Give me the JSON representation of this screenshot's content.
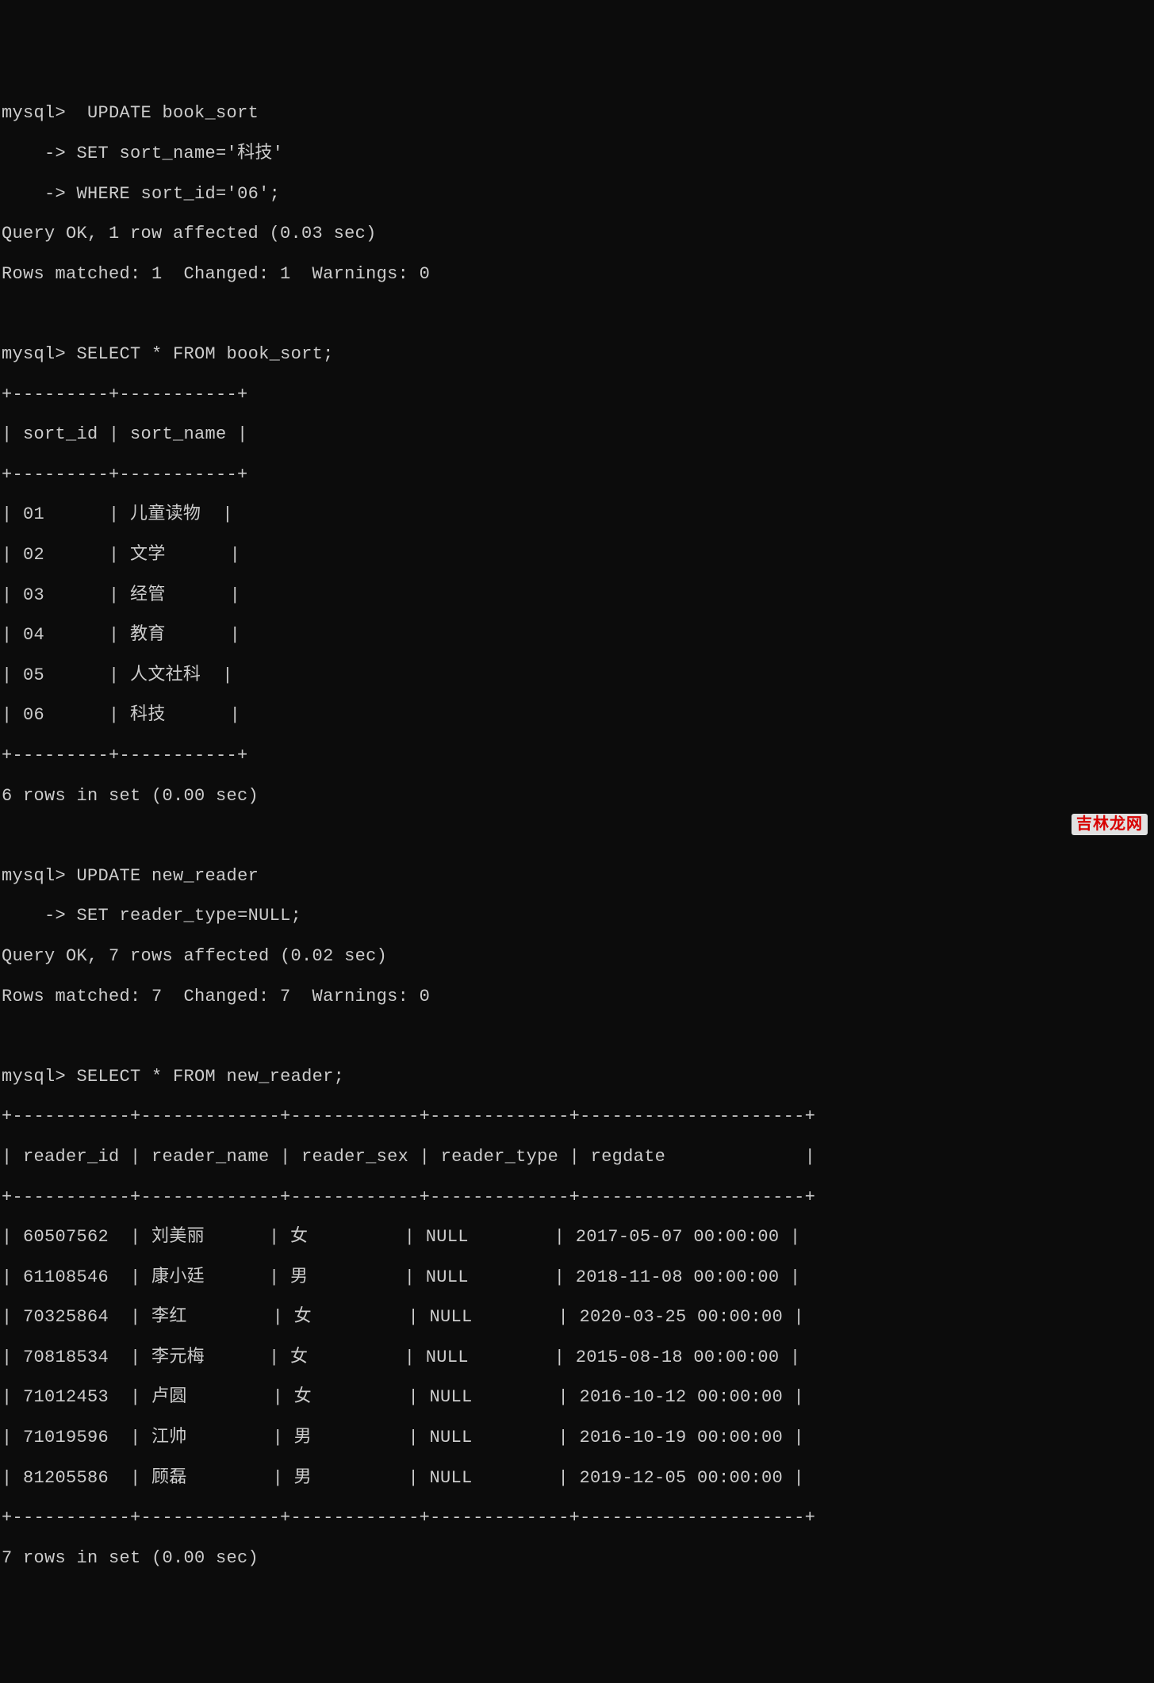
{
  "prompt": "mysql>",
  "cont_prompt": "    ->",
  "query1": {
    "l1": " UPDATE book_sort",
    "l2": "SET sort_name='科技'",
    "l3": "WHERE sort_id='06';"
  },
  "result1": {
    "l1": "Query OK, 1 row affected (0.03 sec)",
    "l2": "Rows matched: 1  Changed: 1  Warnings: 0"
  },
  "query2": "SELECT * FROM book_sort;",
  "table1": {
    "border_top": "+---------+-----------+",
    "header": "| sort_id | sort_name |",
    "border_mid": "+---------+-----------+",
    "rows": [
      "| 01      | 儿童读物  |",
      "| 02      | 文学      |",
      "| 03      | 经管      |",
      "| 04      | 教育      |",
      "| 05      | 人文社科  |",
      "| 06      | 科技      |"
    ],
    "border_bot": "+---------+-----------+",
    "footer": "6 rows in set (0.00 sec)"
  },
  "query3": {
    "l1": "UPDATE new_reader",
    "l2": "SET reader_type=NULL;"
  },
  "result3": {
    "l1": "Query OK, 7 rows affected (0.02 sec)",
    "l2": "Rows matched: 7  Changed: 7  Warnings: 0"
  },
  "query4": "SELECT * FROM new_reader;",
  "table2": {
    "border_top": "+-----------+-------------+------------+-------------+---------------------+",
    "header": "| reader_id | reader_name | reader_sex | reader_type | regdate             |",
    "border_mid": "+-----------+-------------+------------+-------------+---------------------+",
    "rows": [
      "| 60507562  | 刘美丽      | 女         | NULL        | 2017-05-07 00:00:00 |",
      "| 61108546  | 康小廷      | 男         | NULL        | 2018-11-08 00:00:00 |",
      "| 70325864  | 李红        | 女         | NULL        | 2020-03-25 00:00:00 |",
      "| 70818534  | 李元梅      | 女         | NULL        | 2015-08-18 00:00:00 |",
      "| 71012453  | 卢圆        | 女         | NULL        | 2016-10-12 00:00:00 |",
      "| 71019596  | 江帅        | 男         | NULL        | 2016-10-19 00:00:00 |",
      "| 81205586  | 顾磊        | 男         | NULL        | 2019-12-05 00:00:00 |"
    ],
    "border_bot": "+-----------+-------------+------------+-------------+---------------------+",
    "footer": "7 rows in set (0.00 sec)"
  },
  "watermark": "吉林龙网"
}
